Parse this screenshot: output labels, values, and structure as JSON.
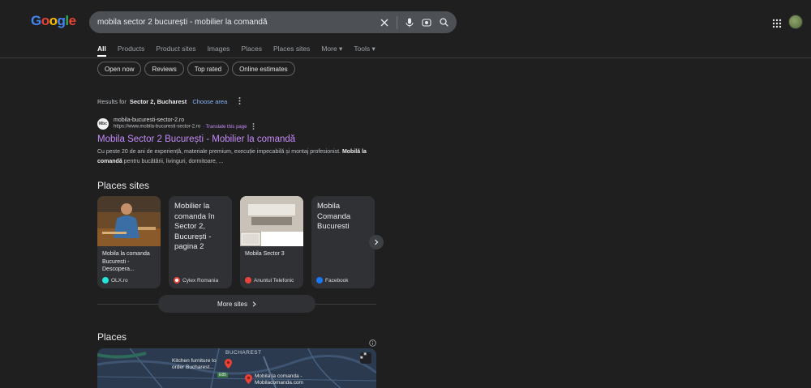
{
  "search": {
    "query": "mobila sector 2 bucurești - mobilier la comandă"
  },
  "logo": {
    "letters": [
      "G",
      "o",
      "o",
      "g",
      "l",
      "e"
    ],
    "colors": [
      "#4285f4",
      "#ea4335",
      "#fbbc05",
      "#4285f4",
      "#34a853",
      "#ea4335"
    ]
  },
  "tabs": [
    "All",
    "Products",
    "Product sites",
    "Images",
    "Places",
    "Places sites",
    "More ▾",
    "Tools ▾"
  ],
  "chips": [
    "Open now",
    "Reviews",
    "Top rated",
    "Online estimates"
  ],
  "location": {
    "prefix": "Results for",
    "place": "Sector 2, Bucharest",
    "change": "Choose area"
  },
  "result": {
    "favicon": "Mbc",
    "site_name": "mobila-bucuresti-sector-2.ro",
    "url": "https://www.mobila-bucuresti-sector-2.ro",
    "translate": "· Translate this page",
    "title": "Mobila Sector 2 București - Mobilier la comandă",
    "snippet_1": "Cu peste 20 de ani de experiență, materiale premium, execuție impecabilă și montaj profesionist. ",
    "snippet_bold_1": "Mobilă",
    "snippet_bold_2": "la comandă",
    "snippet_2": " pentru bucătării, livinguri, dormitoare, ..."
  },
  "places_sites": {
    "heading": "Places sites",
    "cards": [
      {
        "text": "Mobila la comanda Bucuresti - Descopera...",
        "source": "OLX.ro",
        "source_color": "#23e5db"
      },
      {
        "text": "Mobilier la comanda în Sector 2, București - pagina 2",
        "source": "Cylex Romania",
        "source_color": "#ffffff"
      },
      {
        "text": "Mobila Sector 3",
        "source": "Anuntul Telefonic",
        "source_color": "#e8453c"
      },
      {
        "text": "Mobila Comanda Bucuresti",
        "source": "Facebook",
        "source_color": "#1877f2"
      }
    ],
    "more_label": "More sites"
  },
  "places": {
    "heading": "Places",
    "map_labels": [
      "BUCHAREST",
      "Kitchen furniture to order Bucharest...",
      "Mobila la comanda - Mobilacomanda.com",
      "E85"
    ]
  }
}
